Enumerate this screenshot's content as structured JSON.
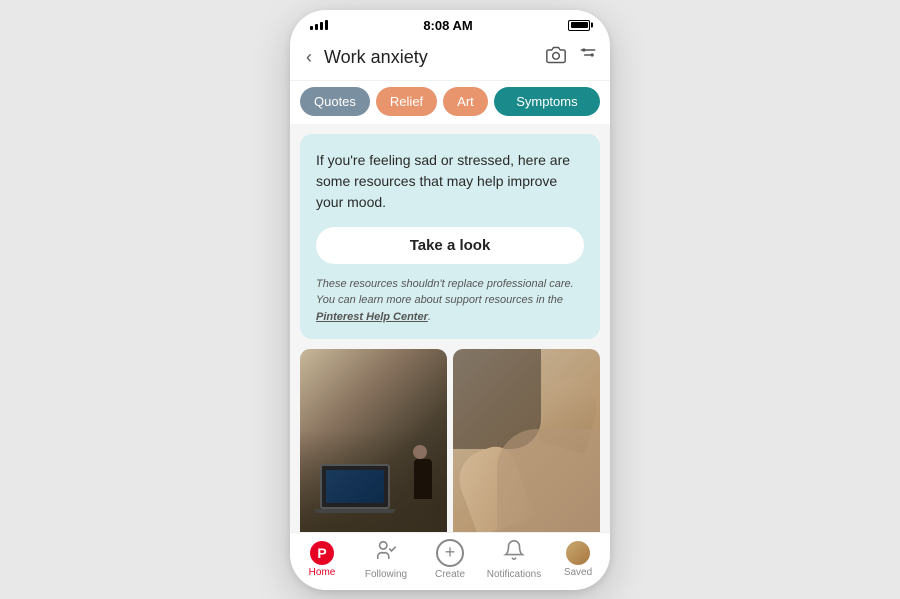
{
  "statusBar": {
    "time": "8:08 AM"
  },
  "header": {
    "title": "Work anxiety",
    "backLabel": "‹",
    "cameraIconLabel": "camera",
    "filterIconLabel": "filter"
  },
  "tabs": [
    {
      "label": "Quotes",
      "style": "quotes"
    },
    {
      "label": "Relief",
      "style": "relief"
    },
    {
      "label": "Art",
      "style": "art"
    },
    {
      "label": "Symptoms",
      "style": "symptoms"
    }
  ],
  "resourceCard": {
    "text": "If you're feeling sad or stressed, here are some resources that may help improve your mood.",
    "buttonLabel": "Take a look",
    "disclaimer": "These resources shouldn't replace professional care. You can learn more about support resources in the ",
    "disclaimerLink": "Pinterest Help Center",
    "disclaimerEnd": "."
  },
  "bottomNav": [
    {
      "label": "Home",
      "active": true
    },
    {
      "label": "Following",
      "active": false
    },
    {
      "label": "Create",
      "active": false
    },
    {
      "label": "Notifications",
      "active": false
    },
    {
      "label": "Saved",
      "active": false
    }
  ]
}
